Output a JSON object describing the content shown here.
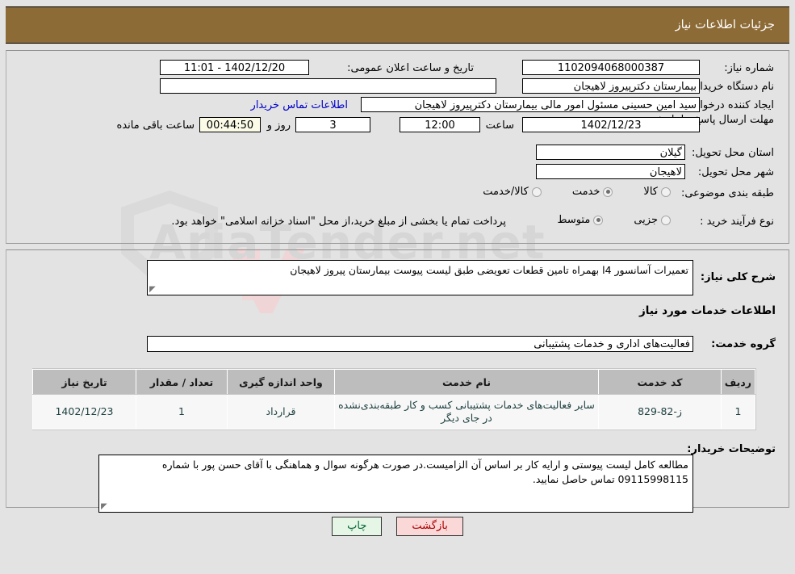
{
  "header": {
    "title": "جزئیات اطلاعات نیاز"
  },
  "top_panel": {
    "fields": {
      "need_number": {
        "label": "شماره نیاز:",
        "value": "1102094068000387"
      },
      "announce_datetime": {
        "label": "تاریخ و ساعت اعلان عمومی:",
        "value": "1402/12/20 - 11:01"
      },
      "buyer_org": {
        "label": "نام دستگاه خریدار:",
        "value": "بیمارستان دکترپیروز لاهیجان"
      },
      "blank_field": {
        "label": "",
        "value": ""
      },
      "creator": {
        "label": "ایجاد کننده درخواست:",
        "value": "سید امین حسینی مسئول امور مالی بیمارستان دکترپیروز لاهیجان"
      },
      "contact_link": {
        "label": "اطلاعات تماس خریدار"
      },
      "deadline": {
        "label": "مهلت ارسال پاسخ: تا تاریخ:",
        "date": "1402/12/23",
        "time_label": "ساعت",
        "time": "12:00",
        "days": "3",
        "days_label": "روز و",
        "timer": "00:44:50",
        "timer_label": "ساعت باقی مانده"
      },
      "province": {
        "label": "استان محل تحویل:",
        "value": "گیلان"
      },
      "city": {
        "label": "شهر محل تحویل:",
        "value": "لاهیجان"
      }
    },
    "category": {
      "label": "طبقه بندی موضوعی:",
      "options": [
        {
          "label": "کالا",
          "selected": false
        },
        {
          "label": "خدمت",
          "selected": true
        },
        {
          "label": "کالا/خدمت",
          "selected": false
        }
      ]
    },
    "purchase_type": {
      "label": "نوع فرآیند خرید :",
      "options": [
        {
          "label": "جزیی",
          "selected": false
        },
        {
          "label": "متوسط",
          "selected": true
        }
      ],
      "checkbox": {
        "label": "پرداخت تمام یا بخشی از مبلغ خرید،از محل \"اسناد خزانه اسلامی\" خواهد بود.",
        "checked": false
      }
    }
  },
  "bottom_panel": {
    "general_desc": {
      "label": "شرح کلی نیاز:",
      "value": "تعمیرات آسانسور 4ا بهمراه تامین قطعات تعویضی طبق لیست پیوست بیمارستان پیروز لاهیجان"
    },
    "services_section_title": "اطلاعات خدمات مورد نیاز",
    "service_group": {
      "label": "گروه خدمت:",
      "value": "فعالیت‌های اداری و خدمات پشتیبانی"
    },
    "table": {
      "headers": [
        "ردیف",
        "کد خدمت",
        "نام خدمت",
        "واحد اندازه گیری",
        "تعداد / مقدار",
        "تاریخ نیاز"
      ],
      "rows": [
        {
          "row_no": "1",
          "service_code": "ز-82-829",
          "service_name": "سایر فعالیت‌های خدمات پشتیبانی کسب و کار طبقه‌بندی‌نشده در جای دیگر",
          "unit": "قرارداد",
          "quantity": "1",
          "need_date": "1402/12/23"
        }
      ]
    },
    "buyer_notes": {
      "label": "توضیحات خریدار:",
      "value": "مطالعه کامل لیست پیوستی و ارایه کار بر اساس آن الزامیست.در صورت هرگونه سوال و هماهنگی با آقای حسن پور با شماره 09115998115 تماس حاصل نمایید."
    }
  },
  "buttons": {
    "print": "چاپ",
    "back": "بازگشت"
  },
  "watermark": {
    "text": "AriaTender.net"
  },
  "colors": {
    "header_bg": "#8d6b36",
    "page_bg": "#e3e3e3",
    "link": "#0000cc",
    "print_btn": "#e6f6e6",
    "back_btn": "#fbd8d8",
    "timer_bg": "#fbfbe8",
    "table_header_bg": "#bdbdbd"
  }
}
